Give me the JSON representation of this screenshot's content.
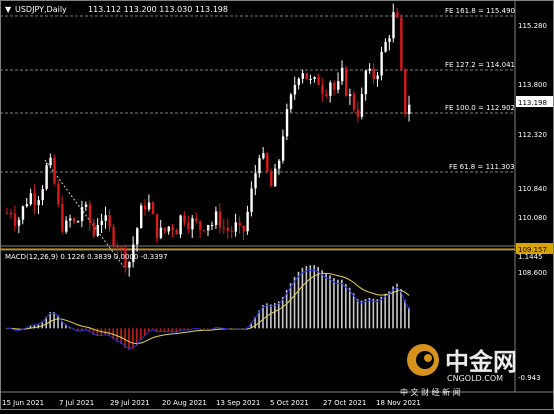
{
  "header": {
    "symbol_label": "USDJPY,Daily",
    "ohlc_values": "113.112 113.200 113.030 113.198",
    "collapse_icon": "triangle-down-icon"
  },
  "price_axis": {
    "ticks": [
      "115.280",
      "113.800",
      "112.320",
      "110.840",
      "110.080",
      "108.600"
    ],
    "current_price": "113.198",
    "level_price": "109.157"
  },
  "fib_levels": [
    {
      "label": "FE 161.8 = 115.490",
      "value": 115.49
    },
    {
      "label": "FE 127.2 = 114.041",
      "value": 114.041
    },
    {
      "label": "FE 100.0 = 112.902",
      "value": 112.902
    },
    {
      "label": "FE 61.8 = 111.303",
      "value": 111.303
    }
  ],
  "macd": {
    "label": "MACD(12,26,9) 0.1226 0.3839 0.0000 -0.3397",
    "axis_top": "1.1445",
    "axis_bottom": "-0.943"
  },
  "time_axis": {
    "labels": [
      "15 Jun 2021",
      "7 Jul 2021",
      "29 Jul 2021",
      "20 Aug 2021",
      "13 Sep 2021",
      "5 Oct 2021",
      "27 Oct 2021",
      "18 Nov 2021"
    ]
  },
  "watermark": {
    "brand": "中金网",
    "subtitle": "中 文 财 经 新 闻",
    "url": "CNGOLD.COM"
  },
  "colors": {
    "up_candle": "#ffffff",
    "down_candle": "#d91a1a",
    "fib_line": "#808080",
    "level_line": "#d7a400",
    "macd_signal": "#e6d84a",
    "macd_line": "#2233dd",
    "hist_pos": "#c8c8c8",
    "hist_neg": "#c02020"
  },
  "chart_data": {
    "type": "candlestick",
    "price_path": [
      [
        0,
        110.2
      ],
      [
        4,
        110.3
      ],
      [
        9,
        110.0
      ],
      [
        14,
        110.1
      ],
      [
        18,
        110.5
      ],
      [
        24,
        110.7
      ],
      [
        30,
        110.6
      ],
      [
        36,
        111.0
      ],
      [
        42,
        111.6
      ],
      [
        46,
        111.3
      ],
      [
        52,
        110.3
      ],
      [
        58,
        109.7
      ],
      [
        64,
        110.0
      ],
      [
        70,
        109.8
      ],
      [
        76,
        110.4
      ],
      [
        82,
        110.1
      ],
      [
        88,
        109.6
      ],
      [
        94,
        110.2
      ],
      [
        100,
        109.9
      ],
      [
        106,
        109.6
      ],
      [
        112,
        109.4
      ],
      [
        118,
        109.0
      ],
      [
        124,
        108.9
      ],
      [
        130,
        109.6
      ],
      [
        136,
        110.2
      ],
      [
        142,
        110.6
      ],
      [
        148,
        110.0
      ],
      [
        154,
        109.6
      ],
      [
        160,
        109.7
      ],
      [
        166,
        109.9
      ],
      [
        172,
        109.8
      ],
      [
        178,
        110.2
      ],
      [
        184,
        110.0
      ],
      [
        190,
        109.9
      ],
      [
        196,
        109.8
      ],
      [
        202,
        110.0
      ],
      [
        208,
        109.9
      ],
      [
        214,
        110.1
      ],
      [
        220,
        109.8
      ],
      [
        226,
        109.7
      ],
      [
        232,
        109.8
      ],
      [
        238,
        109.5
      ],
      [
        244,
        110.2
      ],
      [
        250,
        111.0
      ],
      [
        256,
        111.9
      ],
      [
        262,
        111.4
      ],
      [
        268,
        110.9
      ],
      [
        274,
        111.3
      ],
      [
        280,
        112.4
      ],
      [
        286,
        113.0
      ],
      [
        292,
        113.7
      ],
      [
        298,
        114.2
      ],
      [
        304,
        113.9
      ],
      [
        310,
        113.6
      ],
      [
        316,
        113.8
      ],
      [
        322,
        113.5
      ],
      [
        328,
        113.8
      ],
      [
        334,
        113.4
      ],
      [
        340,
        113.9
      ],
      [
        346,
        113.4
      ],
      [
        352,
        113.1
      ],
      [
        358,
        112.9
      ],
      [
        364,
        114.0
      ],
      [
        370,
        113.8
      ],
      [
        376,
        114.1
      ],
      [
        382,
        114.6
      ],
      [
        388,
        115.1
      ],
      [
        392,
        115.5
      ],
      [
        396,
        115.3
      ],
      [
        400,
        113.9
      ],
      [
        404,
        113.0
      ],
      [
        408,
        113.2
      ]
    ]
  }
}
